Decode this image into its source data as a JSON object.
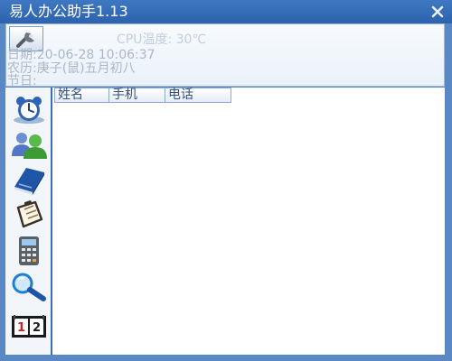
{
  "window": {
    "title": "易人办公助手1.13",
    "close_glyph": "✕"
  },
  "info_panel": {
    "cpu_text": "CPU温度: 30℃",
    "date_label": "日期:",
    "date_value": "20-06-28 10:06:37",
    "lunar_label": "农历:",
    "lunar_value": "庚子(鼠)五月初八",
    "holiday_label": "节日:",
    "holiday_value": ""
  },
  "sidebar": {
    "icons": [
      "wrench-icon",
      "alarm-clock-icon",
      "contacts-icon",
      "book-icon",
      "notepad-icon",
      "calculator-icon",
      "search-icon",
      "calendar-icon"
    ]
  },
  "contacts_table": {
    "columns": [
      "姓名",
      "手机",
      "电话"
    ],
    "rows": []
  },
  "colors": {
    "title_bar": "#2d62ad",
    "frame": "#5a88c4",
    "faded_text": "#a9b7c8",
    "header_text": "#37517a"
  }
}
